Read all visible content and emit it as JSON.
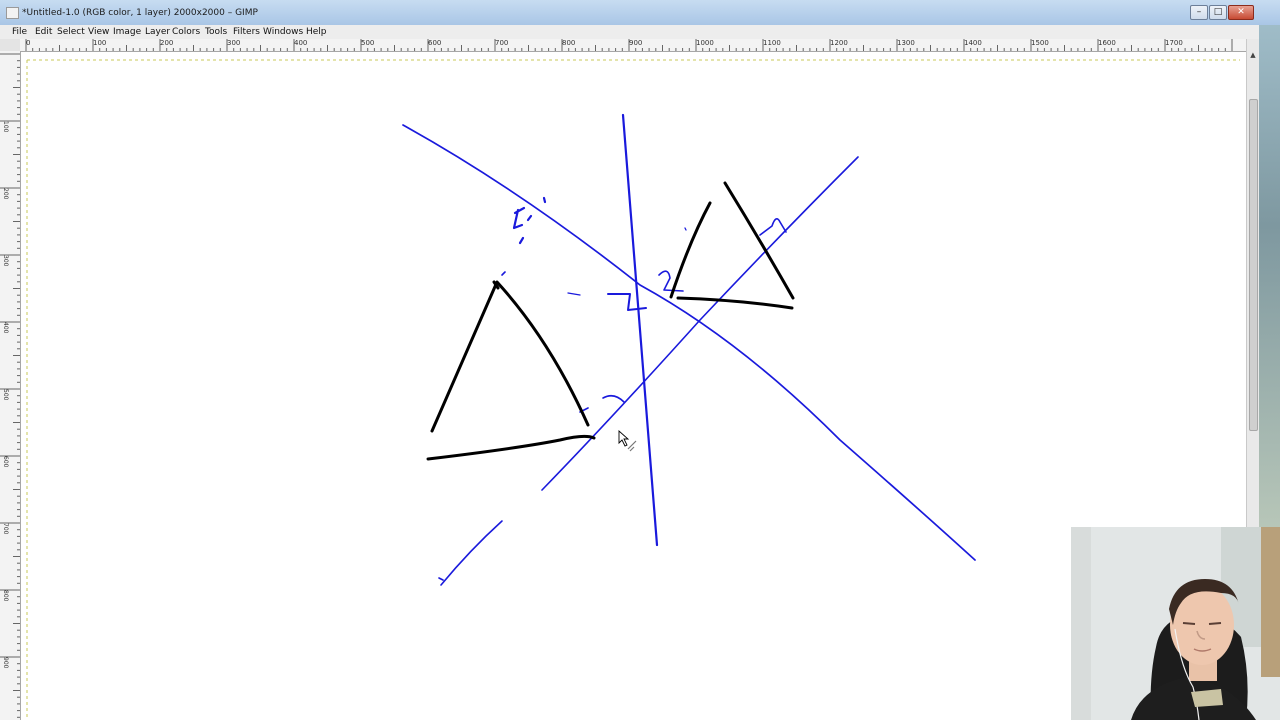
{
  "window": {
    "title": "*Untitled-1.0 (RGB color, 1 layer) 2000x2000 – GIMP",
    "minimize": "–",
    "maximize": "□",
    "close": "✕"
  },
  "menu": [
    "File",
    "Edit",
    "Select",
    "View",
    "Image",
    "Layer",
    "Colors",
    "Tools",
    "Filters",
    "Windows",
    "Help"
  ],
  "rulers": {
    "horizontal": [
      "0",
      "100",
      "200",
      "300",
      "400",
      "500",
      "600",
      "700",
      "800",
      "900",
      "1000",
      "1100",
      "1200",
      "1300",
      "1400",
      "1500",
      "1600",
      "1700"
    ],
    "vertical": [
      "100",
      "200",
      "300",
      "400",
      "500",
      "600",
      "700",
      "800",
      "900",
      "1000"
    ]
  },
  "drawing": {
    "blue_color": "#1a1adc",
    "black_color": "#000000",
    "icons": [
      "mouse-pointer-icon",
      "brush-cursor-icon"
    ]
  }
}
